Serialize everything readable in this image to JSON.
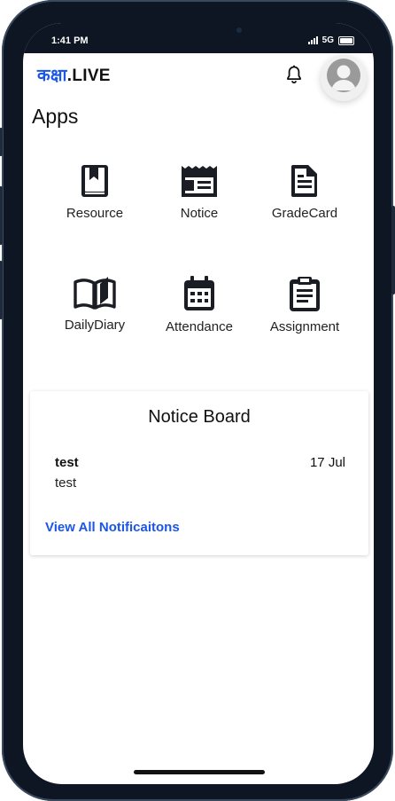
{
  "status_bar": {
    "time": "1:41 PM",
    "network": "5G"
  },
  "header": {
    "logo_brand": "कक्षा",
    "logo_suffix": ".LIVE",
    "notification_icon": "bell-icon",
    "avatar_icon": "user-avatar-icon"
  },
  "apps": {
    "title": "Apps",
    "items": [
      {
        "label": "Resource",
        "icon": "book-bookmark-icon"
      },
      {
        "label": "Notice",
        "icon": "newspaper-icon"
      },
      {
        "label": "GradeCard",
        "icon": "document-icon"
      },
      {
        "label": "DailyDiary",
        "icon": "open-book-icon"
      },
      {
        "label": "Attendance",
        "icon": "calendar-icon"
      },
      {
        "label": "Assignment",
        "icon": "clipboard-icon"
      }
    ]
  },
  "notice_board": {
    "title": "Notice Board",
    "notices": [
      {
        "title": "test",
        "date": "17 Jul",
        "body": "test"
      }
    ],
    "view_all_label": "View All Notificaitons"
  },
  "colors": {
    "accent": "#1a56e8",
    "frame": "#0d1622",
    "icon": "#1a1d23"
  }
}
